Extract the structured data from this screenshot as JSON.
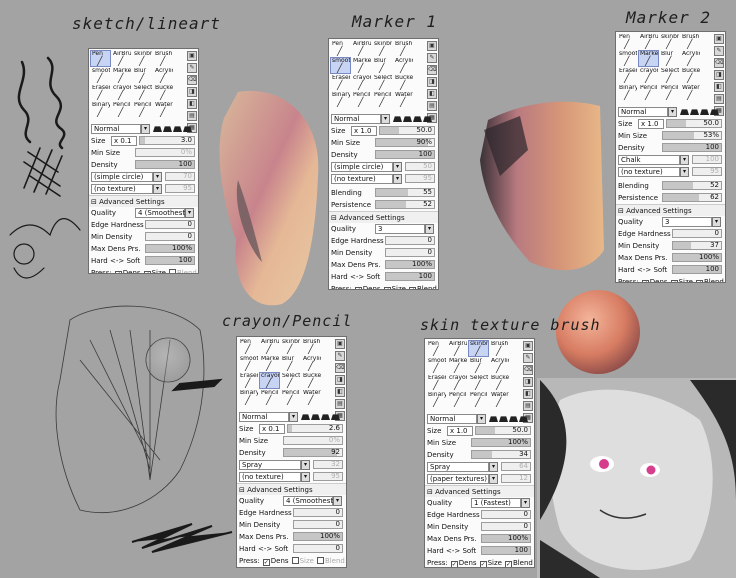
{
  "titles": {
    "t1": "sketch/lineart",
    "t2": "Marker 1",
    "t3": "Marker 2",
    "t4": "crayon/Pencil",
    "t5": "skin texture brush"
  },
  "colors": {
    "background": "#a3a3a3",
    "selected_tool": "#c8d4f3",
    "skin": "#e6a178"
  },
  "tools": [
    "Pen",
    "AirBrush",
    "skinbrusl",
    "Brush",
    "smooth r",
    "Marker",
    "Blur",
    "Acrylic",
    "Eraser",
    "crayonu",
    "Select",
    "Bucket",
    "Binary",
    "Pencil",
    "Pencil",
    "Water"
  ],
  "tool_icons": [
    "pen-icon",
    "airbrush-icon",
    "skinbrush-icon",
    "brush-icon",
    "smooth-icon",
    "marker-icon",
    "blur-icon",
    "acrylic-icon",
    "eraser-icon",
    "crayon-icon",
    "select-icon",
    "bucket-icon",
    "binary-icon",
    "pencil-icon",
    "pencil-icon",
    "water-icon"
  ],
  "labels": {
    "size": "Size",
    "min_size": "Min Size",
    "density": "Density",
    "blending": "Blending",
    "persistence": "Persistence",
    "advanced": "Advanced Settings",
    "quality": "Quality",
    "edge_hardness": "Edge Hardness",
    "min_density": "Min Density",
    "max_dens_prs": "Max Dens Prs.",
    "hard_soft": "Hard <-> Soft",
    "press": "Press:",
    "dens": "Dens",
    "size_chk": "Size",
    "blend": "Blend"
  },
  "panels": {
    "p1": {
      "selected_tool": "Pen",
      "mode": "Normal",
      "mult": "x 0.1",
      "size": "3.0",
      "size_fill": 0.1,
      "min_size": "0%",
      "min_size_fill": 0,
      "density": "100",
      "density_fill": 1,
      "shape": "(simple circle)",
      "shape_val": "70",
      "texture": "(no texture)",
      "texture_val": "95",
      "quality": "4 (Smoothest)",
      "edge_hardness": "0",
      "min_density": "0",
      "max_dens_prs": "100%",
      "hard_soft": "100",
      "press_dens": true,
      "press_size": true,
      "press_blend": false
    },
    "p2": {
      "selected_tool": "smooth r",
      "mode": "Normal",
      "mult": "x 1.0",
      "size": "50.0",
      "size_fill": 0.35,
      "min_size": "90%",
      "min_size_fill": 0.9,
      "density": "100",
      "density_fill": 1,
      "shape": "(simple circle)",
      "shape_val": "50",
      "texture": "(no texture)",
      "texture_val": "95",
      "blending": "55",
      "blending_fill": 0.55,
      "persistence": "52",
      "persistence_fill": 0.52,
      "quality": "3",
      "edge_hardness": "0",
      "min_density": "0",
      "max_dens_prs": "100%",
      "hard_soft": "100",
      "press_dens": true,
      "press_size": true,
      "press_blend": true
    },
    "p3": {
      "selected_tool": "Marker",
      "mode": "Normal",
      "mult": "x 1.0",
      "size": "50.0",
      "size_fill": 0.35,
      "min_size": "53%",
      "min_size_fill": 0.53,
      "density": "100",
      "density_fill": 1,
      "shape": "Chalk",
      "shape_val": "100",
      "texture": "(no texture)",
      "texture_val": "95",
      "blending": "52",
      "blending_fill": 0.52,
      "persistence": "62",
      "persistence_fill": 0.62,
      "quality": "3",
      "edge_hardness": "0",
      "min_density": "37",
      "max_dens_prs": "100%",
      "hard_soft": "100",
      "press_dens": true,
      "press_size": true,
      "press_blend": true
    },
    "p4": {
      "selected_tool": "crayonu",
      "mode": "Normal",
      "mult": "x 0.1",
      "size": "2.6",
      "size_fill": 0.08,
      "min_size": "0%",
      "min_size_fill": 0,
      "density": "92",
      "density_fill": 0.92,
      "shape": "Spray",
      "shape_val": "32",
      "texture": "(no texture)",
      "texture_val": "95",
      "quality": "4 (Smoothest)",
      "edge_hardness": "0",
      "min_density": "0",
      "max_dens_prs": "100%",
      "hard_soft": "0",
      "press_dens": true,
      "press_size": false,
      "press_blend": false
    },
    "p5": {
      "selected_tool": "skinbrusl",
      "mode": "Normal",
      "mult": "x 1.0",
      "size": "50.0",
      "size_fill": 0.35,
      "min_size": "100%",
      "min_size_fill": 1,
      "density": "34",
      "density_fill": 0.34,
      "shape": "Spray",
      "shape_val": "64",
      "texture": "(paper textures)",
      "texture_val": "12",
      "quality": "1 (Fastest)",
      "edge_hardness": "0",
      "min_density": "0",
      "max_dens_prs": "100%",
      "hard_soft": "100",
      "press_dens": true,
      "press_size": true,
      "press_blend": true
    }
  }
}
